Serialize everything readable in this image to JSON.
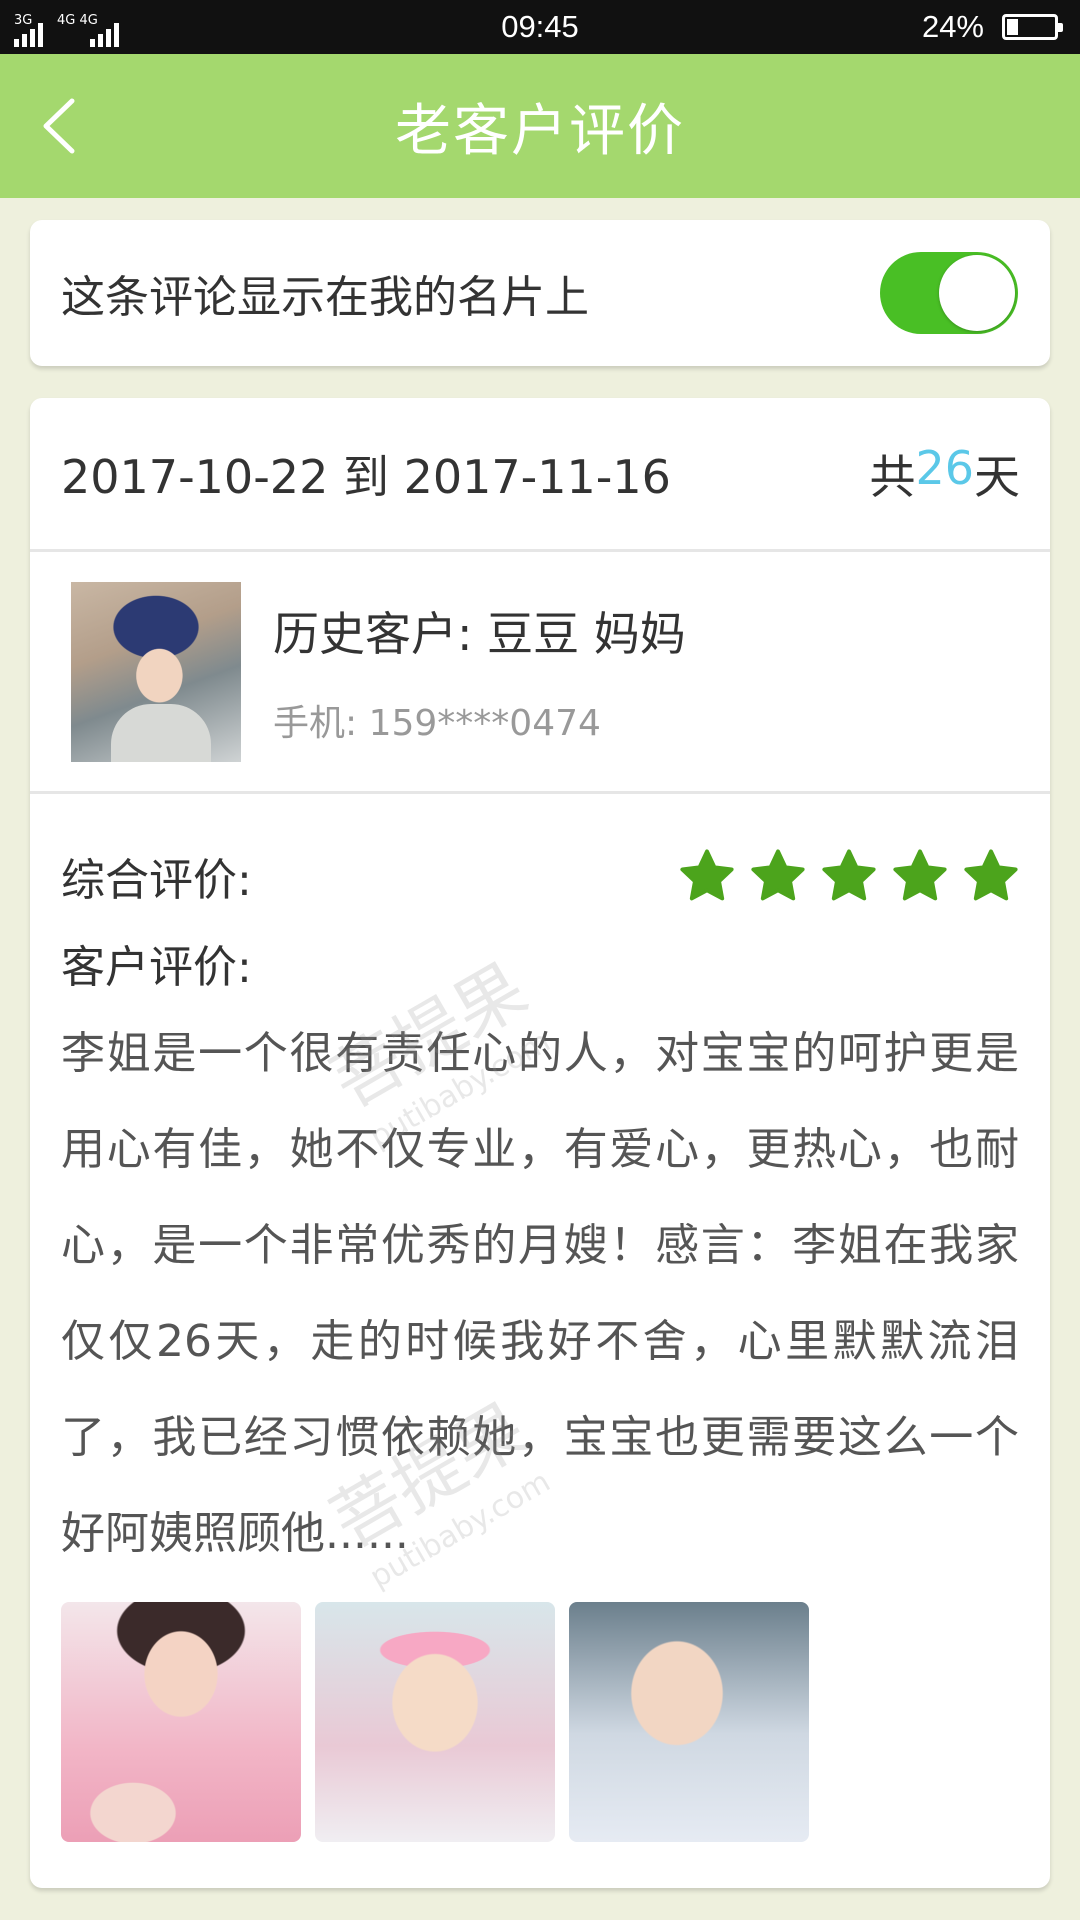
{
  "status_bar": {
    "network_1": "3G",
    "network_2": "4G 4G",
    "time": "09:45",
    "battery_percent": "24%",
    "battery_level": 0.24
  },
  "header": {
    "title": "老客户评价",
    "back_icon": "chevron-left-icon"
  },
  "display_setting": {
    "label": "这条评论显示在我的名片上",
    "enabled": true,
    "toggle_color": "#49bf25"
  },
  "service": {
    "date_range": "2017-10-22 到 2017-11-16",
    "duration_prefix": "共",
    "duration_days": "26",
    "duration_suffix": "天"
  },
  "customer": {
    "name": "历史客户: 豆豆 妈妈",
    "phone": "手机: 159****0474"
  },
  "rating": {
    "label": "综合评价:",
    "stars": 5,
    "max_stars": 5,
    "star_color": "#4ca41c"
  },
  "review": {
    "label": "客户评价:",
    "text": "李姐是一个很有责任心的人，对宝宝的呵护更是用心有佳，她不仅专业，有爱心，更热心，也耐心，是一个非常优秀的月嫂！感言：李姐在我家仅仅26天，走的时候我好不舍，心里默默流泪了，我已经习惯依赖她，宝宝也更需要这么一个好阿姨照顾他......"
  },
  "watermark": {
    "text": "菩提果",
    "domain": "putibaby.com"
  },
  "colors": {
    "header_bg": "#a4d86e",
    "page_bg": "#eef0dd",
    "accent_number": "#5bc8e8"
  }
}
